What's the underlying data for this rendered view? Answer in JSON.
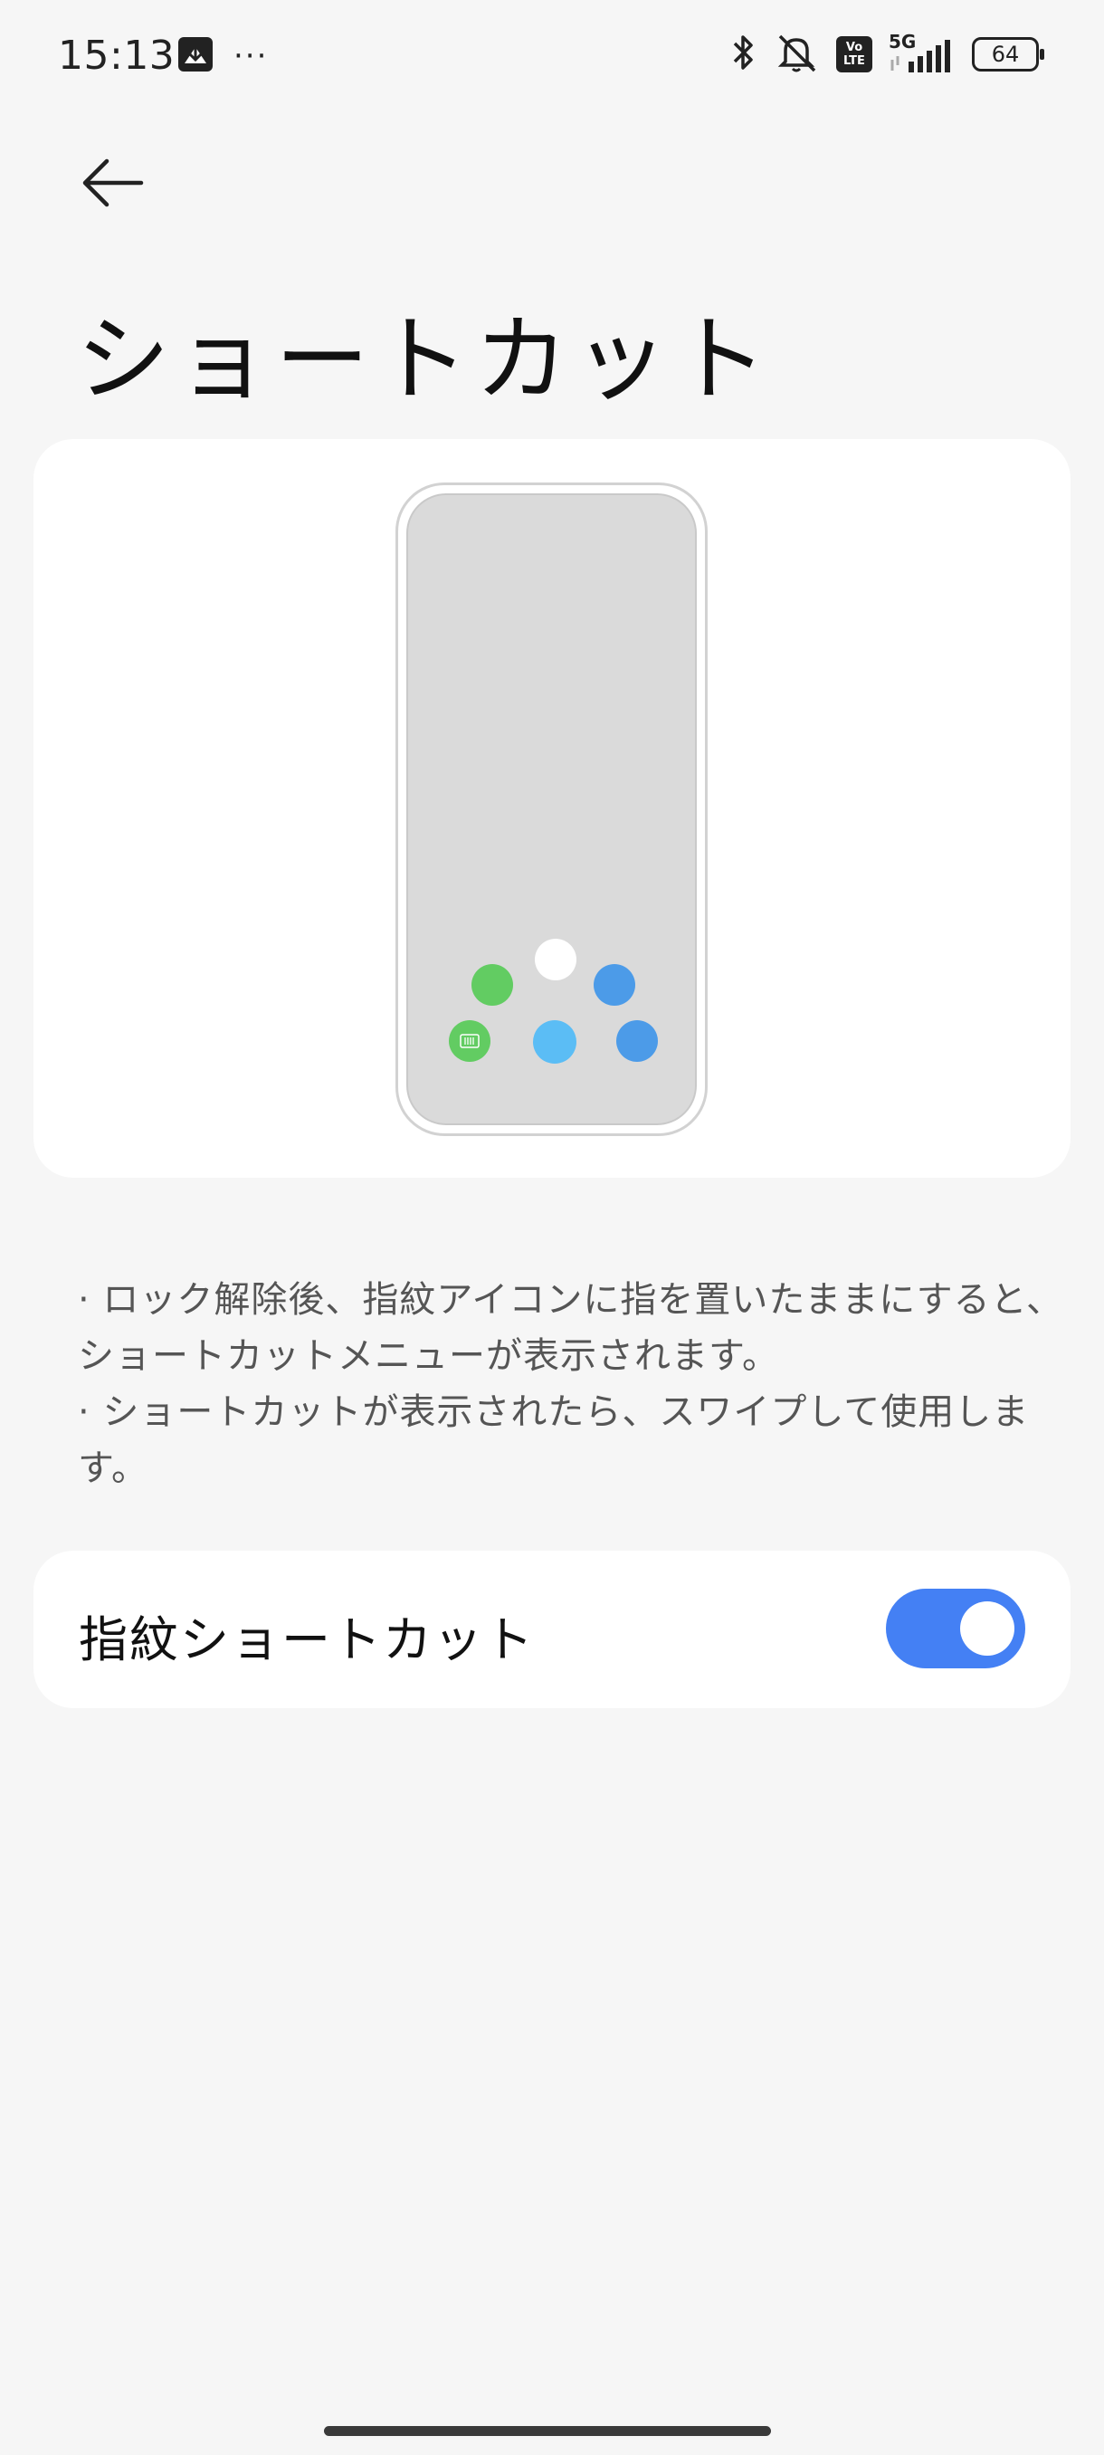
{
  "status_bar": {
    "time": "15:13",
    "ellipsis": "···",
    "battery_level": "64",
    "network": "5G",
    "volte_top": "Vo",
    "volte_bottom": "LTE"
  },
  "header": {
    "title": "ショートカット"
  },
  "description": {
    "line1": "· ロック解除後、指紋アイコンに指を置いたままにすると、ショートカットメニューが表示されます。",
    "line2": "· ショートカットが表示されたら、スワイプして使用します。"
  },
  "setting": {
    "label": "指紋ショートカット",
    "enabled": true
  },
  "colors": {
    "accent": "#4480f4",
    "green": "#62cc62",
    "blue": "#4c9be8",
    "light_blue": "#5bbdf5"
  }
}
